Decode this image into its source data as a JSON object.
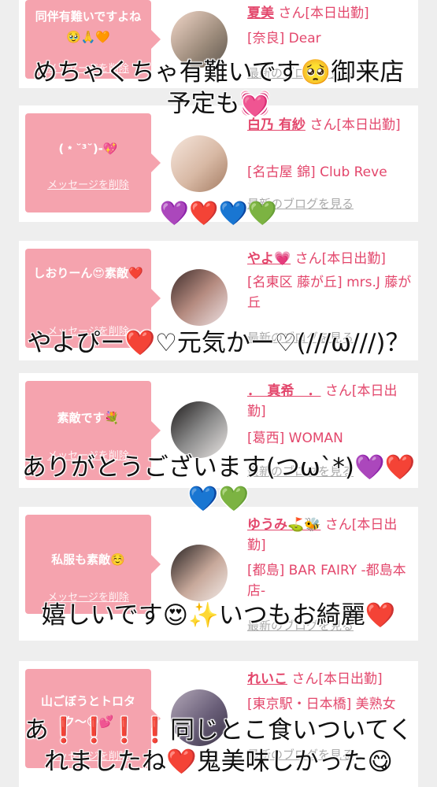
{
  "cards": [
    {
      "message": "同伴有難いですよね🥹🙏🧡",
      "delete_label": "メッセージを削除",
      "name": "夏美",
      "name_suffix": " さん[本日出勤]",
      "shop": "[奈良] Dear",
      "blog_label": "最新のブログを見る"
    },
    {
      "message": "(﹡˘³˘)-💖",
      "delete_label": "メッセージを削除",
      "name": "白乃 有紗",
      "name_suffix": " さん[本日出勤]",
      "shop": "[名古屋 錦] Club Reve",
      "blog_label": "最新のブログを見る"
    },
    {
      "message": "しおりーん😍素敵❤️",
      "delete_label": "メッセージを削除",
      "name": "やよ💗",
      "name_suffix": " さん[本日出勤]",
      "shop": "[名東区 藤が丘] mrs.J 藤が丘",
      "blog_label": "最新のブログを見る"
    },
    {
      "message": "素敵です💐",
      "delete_label": "メッセージを削除",
      "name": "．　真希　．",
      "name_suffix": " さん[本日出勤]",
      "shop": "[葛西] WOMAN",
      "blog_label": "最新のブログを見る"
    },
    {
      "message": "私服も素敵☺️",
      "delete_label": "メッセージを削除",
      "name": "ゆうみ⛳️🐝",
      "name_suffix": " さん[本日出勤]",
      "shop": "[都島] BAR FAIRY -都島本店-",
      "blog_label": "最新のブログを見る"
    },
    {
      "message": "山ごぼうとトロタク〜😌💕",
      "delete_label": "メッセージを削除",
      "name": "れいこ",
      "name_suffix": " さん[本日出勤]",
      "shop": "[東京駅・日本橋] 美熟女",
      "blog_label": "最新のブログを見る"
    }
  ],
  "captions": [
    "めちゃくちゃ有難いです🥺御来店\n予定も💓",
    "💜❤️💙💚",
    "やよぴー❤️♡元気かー♡(///ω///)？",
    "ありがとうございます(つω`*)💜❤️\n💙💚",
    "嬉しいです😍✨いつもお綺麗❤️",
    "あ❗️❗️❗️❗️同じとこ食いついてく\nれましたね❤️鬼美味しかった😋"
  ],
  "colors": {
    "bubble": "#f5a3ae",
    "name_text": "#e3476c",
    "page_bg": "#eeeeee"
  }
}
